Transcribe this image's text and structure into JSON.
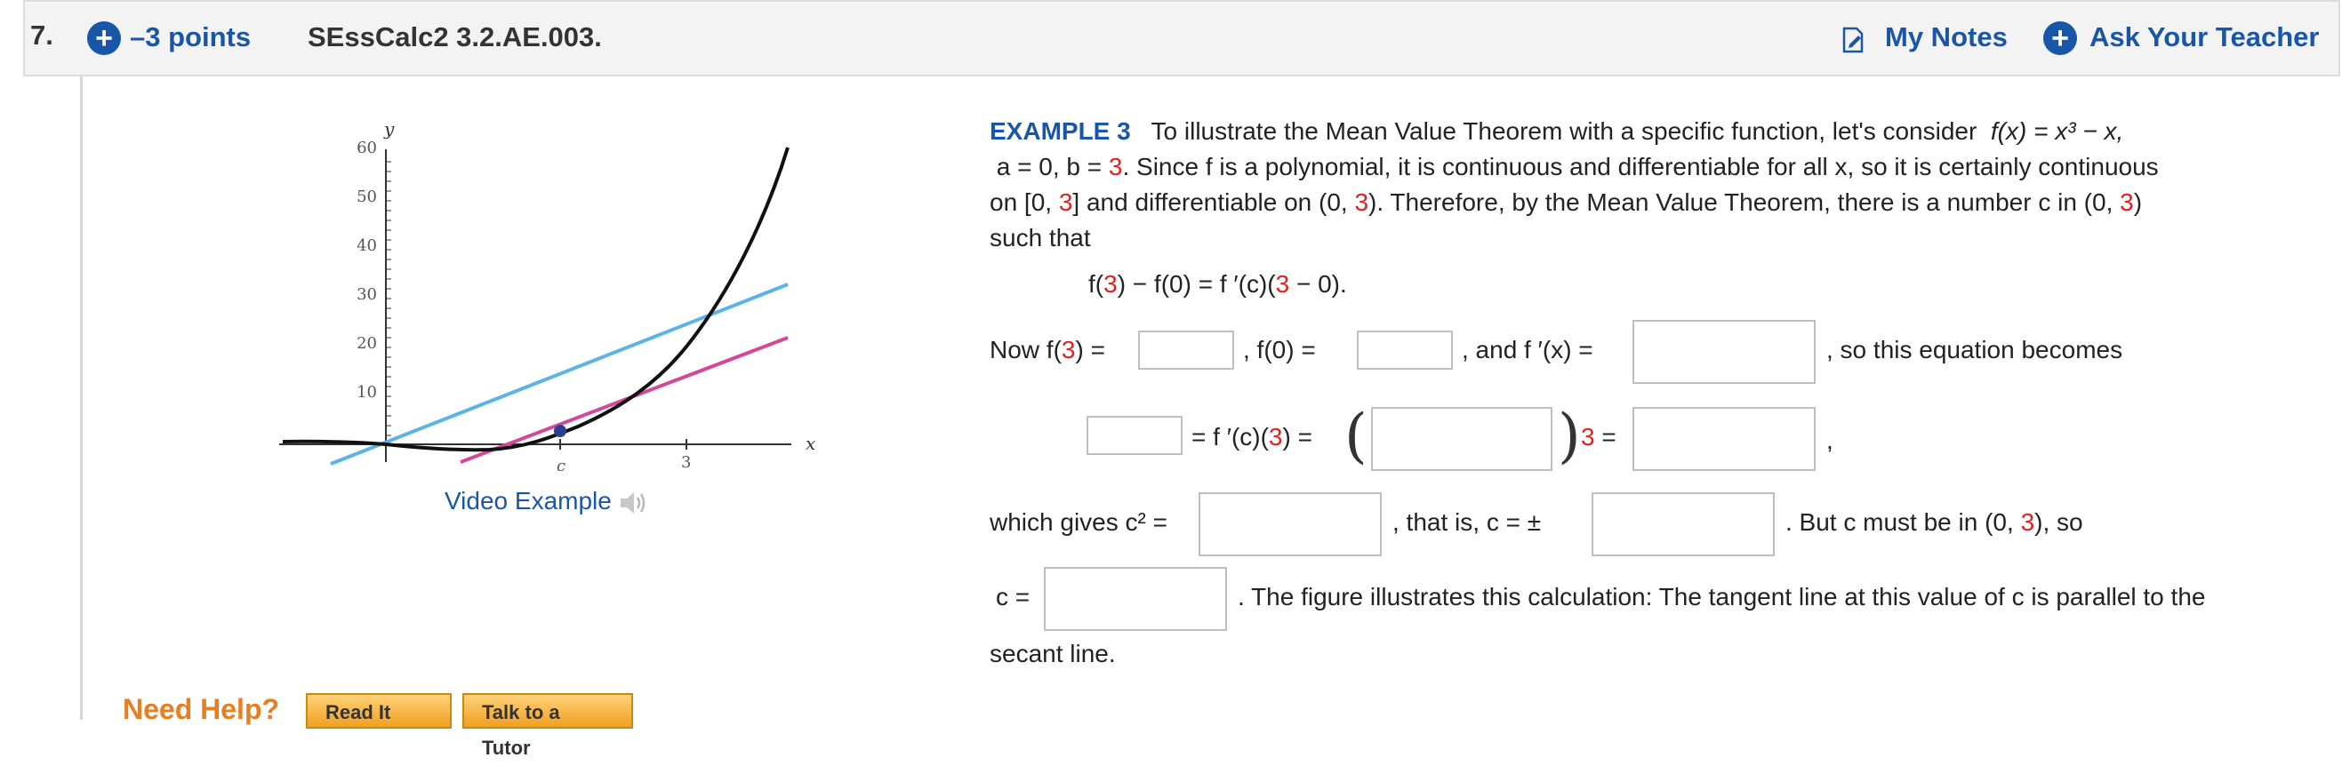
{
  "header": {
    "question_number": "7.",
    "points": "–3 points",
    "question_id": "SEssCalc2 3.2.AE.003.",
    "my_notes": "My Notes",
    "ask_teacher": "Ask Your Teacher"
  },
  "graph": {
    "y_axis_label": "y",
    "x_axis_label": "x",
    "y_ticks": [
      "10",
      "20",
      "30",
      "40",
      "50",
      "60"
    ],
    "x_ticks": [
      "c",
      "3"
    ],
    "colors": {
      "curve": "#111111",
      "secant": "#5ab4e6",
      "tangent": "#d4489a",
      "point": "#2a3f8f"
    }
  },
  "video_example": "Video Example",
  "help": {
    "need_help": "Need Help?",
    "read_it": "Read It",
    "talk_tutor": "Talk to a Tutor"
  },
  "example": {
    "label": "EXAMPLE 3",
    "line1": "To illustrate the Mean Value Theorem with a specific function, let's consider",
    "func": "f(x) = x³ − x,",
    "line2a": "a = 0,  b = ",
    "line2b": "3",
    "line2c": ".  Since f is a polynomial, it is continuous and differentiable for all x, so it is certainly continuous",
    "line3a": "on  [0, ",
    "line3b": "3",
    "line3c": "]  and differentiable on  (0, ",
    "line3d": "3",
    "line3e": ").  Therefore, by the Mean Value Theorem, there is a number c in  (0, ",
    "line3f": "3",
    "line3g": ")",
    "line4": "such that",
    "eq_a": "f(",
    "eq_b": "3",
    "eq_c": ") − f(0) = f ′(c)(",
    "eq_d": "3",
    "eq_e": " − 0).",
    "now_a": "Now  f(",
    "now_b": "3",
    "now_c": ") =",
    "f0": ",     f(0) =",
    "andfp": ",   and  f ′(x) =",
    "becomes": ",   so this equation becomes",
    "eq2_a": "=  f ′(c)(",
    "eq2_b": "3",
    "eq2_c": ") =",
    "eq2_d": "3",
    "eq2_e": " =",
    "comma": ",",
    "gives_a": "which gives  c² =",
    "gives_b": ",  that is,  c = ±",
    "gives_c": ".  But c must be in  (0, ",
    "gives_d": "3",
    "gives_e": "),  so",
    "c_eq": "c =",
    "figure_text": ".  The figure illustrates this calculation: The tangent line at this value of c is parallel to the",
    "secant": "secant line."
  },
  "inputs": {
    "f3": "",
    "f0": "",
    "fprime": "",
    "lhs": "",
    "fc3_inner": "",
    "rhs": "",
    "c_squared": "",
    "c_pm": "",
    "c_value": ""
  }
}
